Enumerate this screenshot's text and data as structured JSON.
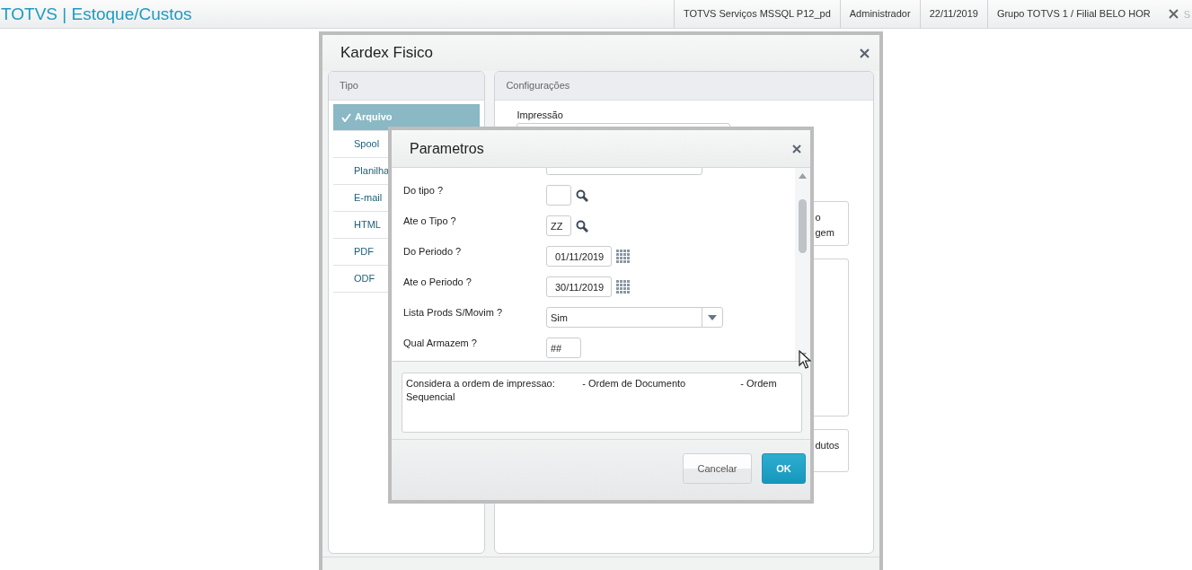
{
  "app_bar": {
    "title": "TOTVS | Estoque/Custos",
    "info": [
      "TOTVS Serviços MSSQL P12_pd",
      "Administrador",
      "22/11/2019",
      "Grupo TOTVS 1 / Filial BELO HOR"
    ],
    "cut_label": "S"
  },
  "dialog": {
    "title": "Kardex Fisico",
    "tipo_panel": {
      "title": "Tipo",
      "items": [
        {
          "label": "Arquivo",
          "selected": true
        },
        {
          "label": "Spool",
          "selected": false
        },
        {
          "label": "Planilha",
          "selected": false
        },
        {
          "label": "E-mail",
          "selected": false
        },
        {
          "label": "HTML",
          "selected": false
        },
        {
          "label": "PDF",
          "selected": false
        },
        {
          "label": "ODF",
          "selected": false
        }
      ]
    },
    "config_panel": {
      "title": "Configurações",
      "print_label": "Impressão",
      "boxes": [
        {
          "kind": "text",
          "lines": [
            "o",
            "gem"
          ]
        },
        {
          "kind": "empty"
        },
        {
          "kind": "text",
          "lines": [
            "dutos"
          ]
        }
      ]
    }
  },
  "params": {
    "title": "Parametros",
    "rows": [
      {
        "kind": "clipped"
      },
      {
        "kind": "lookup",
        "label": "Do tipo ?"
      },
      {
        "kind": "lookup",
        "label": "Ate o Tipo ?",
        "value": "ZZ"
      },
      {
        "kind": "date",
        "label": "Do Periodo ?",
        "value": "01/11/2019"
      },
      {
        "kind": "date",
        "label": "Ate o Periodo ?",
        "value": "30/11/2019"
      },
      {
        "kind": "select",
        "label": "Lista Prods S/Movim ?",
        "value": "Sim"
      },
      {
        "kind": "text",
        "label": "Qual Armazem ?",
        "value": "##"
      }
    ],
    "description": "Considera a ordem de impressao:          - Ordem de Documento                    - Ordem Sequencial",
    "buttons": [
      {
        "label": "Cancelar",
        "kind": "secondary"
      },
      {
        "label": "OK",
        "kind": "primary"
      }
    ]
  }
}
